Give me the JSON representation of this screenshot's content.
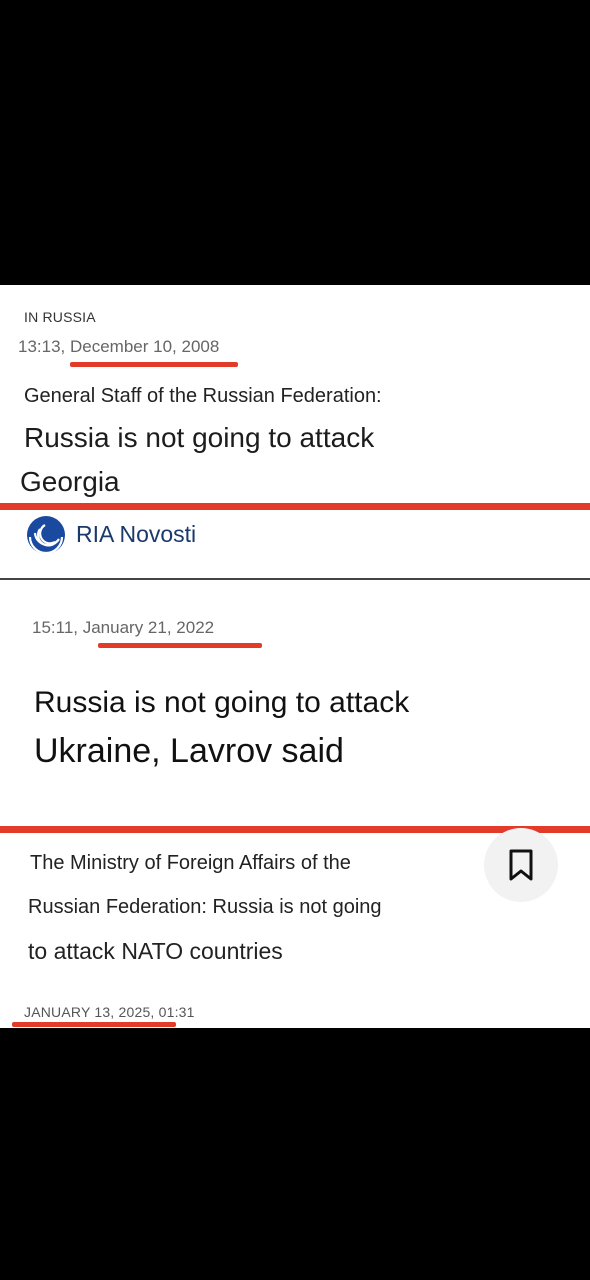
{
  "section1": {
    "category": "IN RUSSIA",
    "timestamp": "13:13, December 10, 2008",
    "kicker": "General Staff of the Russian Federation:",
    "headline_line1": "Russia is not going to attack",
    "headline_line2": "Georgia",
    "source": "RIA Novosti"
  },
  "section2": {
    "timestamp": "15:11, January 21, 2022",
    "headline_line1": "Russia is not going to attack",
    "headline_line2": "Ukraine, Lavrov said"
  },
  "section3": {
    "line1": "The Ministry of Foreign Affairs of the",
    "line2": "Russian Federation: Russia is not going",
    "line3": "to attack NATO countries",
    "date": "JANUARY 13, 2025, 01:31",
    "bookmark_icon": "bookmark-icon"
  },
  "colors": {
    "highlight_red": "#e23b2a",
    "ria_blue": "#1a4aa0",
    "text_dark": "#1c1c1c",
    "text_gray": "#666666"
  }
}
